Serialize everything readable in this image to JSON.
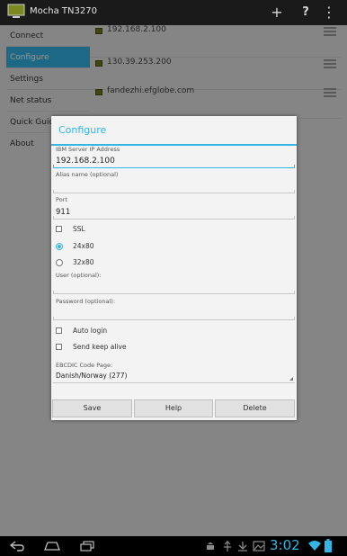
{
  "app": {
    "title": "Mocha TN3270"
  },
  "action_bar": {
    "add_label": "+",
    "help_label": "?",
    "overflow_label": "⋮"
  },
  "sidebar": {
    "items": [
      {
        "label": "Connect"
      },
      {
        "label": "Configure",
        "active": true
      },
      {
        "label": "Settings"
      },
      {
        "label": "Net status"
      },
      {
        "label": "Quick Guide"
      },
      {
        "label": "About"
      }
    ]
  },
  "hosts": [
    {
      "address": "192.168.2.100"
    },
    {
      "address": "130.39.253.200"
    },
    {
      "address": "fandezhi.efglobe.com"
    }
  ],
  "dialog": {
    "title": "Configure",
    "server_label": "IBM Server IP Address",
    "server_value": "192.168.2.100",
    "alias_label": "Alias name (optional)",
    "alias_value": "",
    "port_label": "Port",
    "port_value": "911",
    "ssl_label": "SSL",
    "ssl_checked": false,
    "size_options": [
      {
        "label": "24x80",
        "selected": true
      },
      {
        "label": "32x80",
        "selected": false
      }
    ],
    "user_label": "User (optional):",
    "user_value": "",
    "password_label": "Password (optional):",
    "password_value": "",
    "auto_login_label": "Auto login",
    "auto_login_checked": false,
    "keep_alive_label": "Send keep alive",
    "keep_alive_checked": false,
    "codepage_label": "EBCDIC Code Page:",
    "codepage_value": "Danish/Norway (277)",
    "buttons": {
      "save": "Save",
      "help": "Help",
      "delete": "Delete"
    }
  },
  "status": {
    "time": "3:02"
  },
  "colors": {
    "accent": "#33b5e5",
    "active_nav": "#33b5e5"
  }
}
